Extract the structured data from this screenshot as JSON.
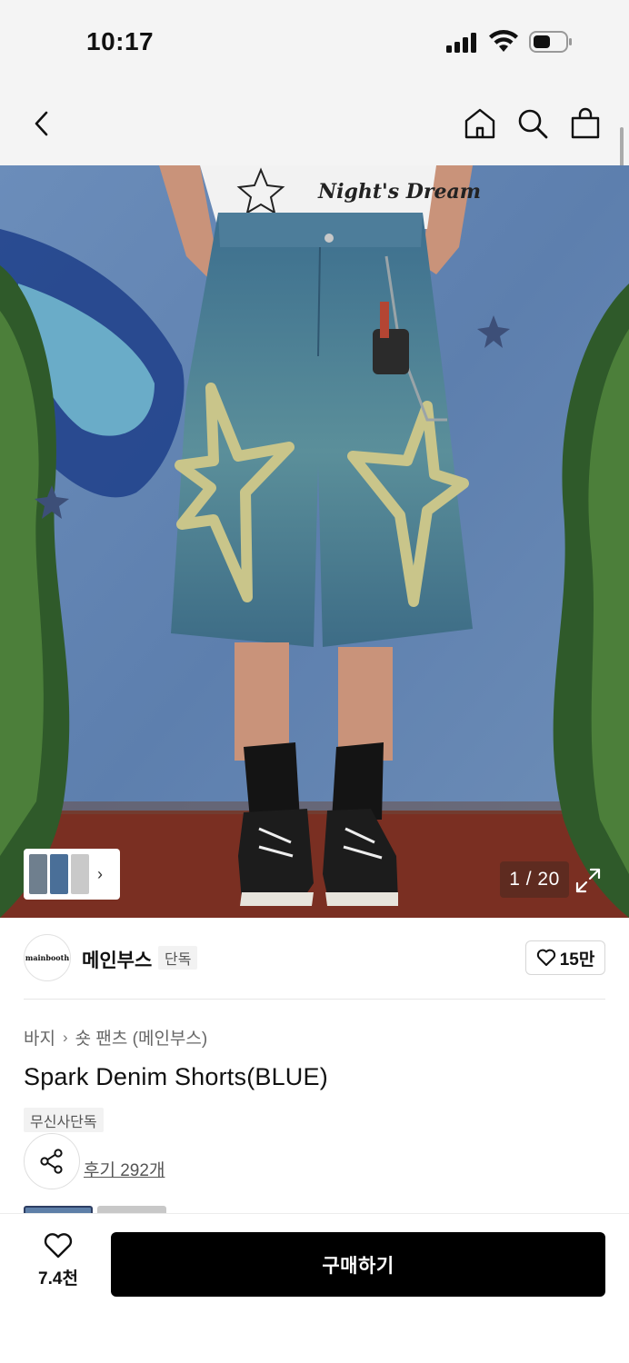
{
  "status_bar": {
    "time": "10:17"
  },
  "nav": {
    "back_icon": "chevron-left-icon",
    "home_icon": "home-icon",
    "search_icon": "search-icon",
    "bag_icon": "shopping-bag-icon"
  },
  "gallery": {
    "counter": "1 / 20",
    "expand_icon": "expand-icon",
    "thumb_chevron": "›"
  },
  "brand": {
    "logo_text": "mainbooth",
    "name": "메인부스",
    "badge": "단독",
    "likes": "15만"
  },
  "product": {
    "breadcrumb": [
      "바지",
      "숏 팬츠 (메인부스)"
    ],
    "breadcrumb_sep": "›",
    "title": "Spark Denim Shorts(BLUE)",
    "exclusive_tag": "무신사단독",
    "review_text": "후기 292개"
  },
  "bottom_bar": {
    "wish_count": "7.4천",
    "buy_label": "구매하기"
  },
  "colors": {
    "background": "#ffffff",
    "header_bg": "#f4f4f4",
    "buy_button": "#000000",
    "tag_bg": "#f2f2f2"
  }
}
